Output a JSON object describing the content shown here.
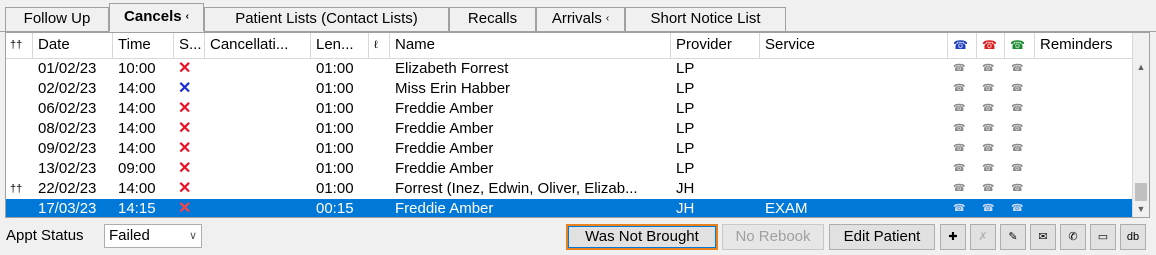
{
  "tabs": [
    {
      "label": "Follow Up"
    },
    {
      "label": "Cancels",
      "arrow": "‹"
    },
    {
      "label": "Patient Lists (Contact Lists)"
    },
    {
      "label": "Recalls"
    },
    {
      "label": "Arrivals",
      "arrow": "‹"
    },
    {
      "label": "Short Notice List"
    }
  ],
  "grid": {
    "headers": {
      "family": "††",
      "date": "Date",
      "time": "Time",
      "status": "S...",
      "cancellation": "Cancellati...",
      "length": "Len...",
      "note": "ℓ",
      "name": "Name",
      "provider": "Provider",
      "service": "Service",
      "phone_blue": "☎",
      "phone_red": "☎",
      "phone_green": "☎",
      "reminders": "Reminders",
      "column_chooser": "∩"
    },
    "rows": [
      {
        "family": "",
        "date": "01/02/23",
        "time": "10:00",
        "status": "✕",
        "length": "01:00",
        "name": "Elizabeth Forrest",
        "provider": "LP",
        "service": ""
      },
      {
        "family": "",
        "date": "02/02/23",
        "time": "14:00",
        "status": "✕",
        "length": "01:00",
        "name": "Miss Erin Habber",
        "provider": "LP",
        "service": ""
      },
      {
        "family": "",
        "date": "06/02/23",
        "time": "14:00",
        "status": "✕",
        "length": "01:00",
        "name": "Freddie Amber",
        "provider": "LP",
        "service": ""
      },
      {
        "family": "",
        "date": "08/02/23",
        "time": "14:00",
        "status": "✕",
        "length": "01:00",
        "name": "Freddie Amber",
        "provider": "LP",
        "service": ""
      },
      {
        "family": "",
        "date": "09/02/23",
        "time": "14:00",
        "status": "✕",
        "length": "01:00",
        "name": "Freddie Amber",
        "provider": "LP",
        "service": ""
      },
      {
        "family": "",
        "date": "13/02/23",
        "time": "09:00",
        "status": "✕",
        "length": "01:00",
        "name": "Freddie Amber",
        "provider": "LP",
        "service": ""
      },
      {
        "family": "††",
        "date": "22/02/23",
        "time": "14:00",
        "status": "✕",
        "length": "01:00",
        "name": "Forrest (Inez, Edwin, Oliver, Elizab...",
        "provider": "JH",
        "service": ""
      },
      {
        "family": "",
        "date": "17/03/23",
        "time": "14:15",
        "status": "✕",
        "length": "00:15",
        "name": "Freddie Amber",
        "provider": "JH",
        "service": "EXAM"
      }
    ],
    "status_colors": [
      "#e81123",
      "#1b2fd1",
      "#e81123",
      "#e81123",
      "#e81123",
      "#e81123",
      "#e81123",
      "#e81123"
    ],
    "phone_glyph": "☎",
    "scroll_up": "▲",
    "scroll_down": "▼"
  },
  "colors": {
    "selection": "#0078d7",
    "phone_blue": "#1f3fbf",
    "phone_red": "#d92020",
    "phone_green": "#1a8a2e",
    "focus_border": "#e8821e"
  },
  "bottom": {
    "appt_status_label": "Appt Status",
    "appt_status_value": "Failed",
    "select_caret": "∨",
    "was_not_brought": "Was Not Brought",
    "no_rebook": "No Rebook",
    "edit_patient": "Edit Patient",
    "icon_buttons": [
      {
        "glyph": "✚"
      },
      {
        "glyph": "✗"
      },
      {
        "glyph": "✎"
      },
      {
        "glyph": "✉"
      },
      {
        "glyph": "✆"
      },
      {
        "glyph": "▭"
      },
      {
        "glyph": "db"
      }
    ]
  }
}
